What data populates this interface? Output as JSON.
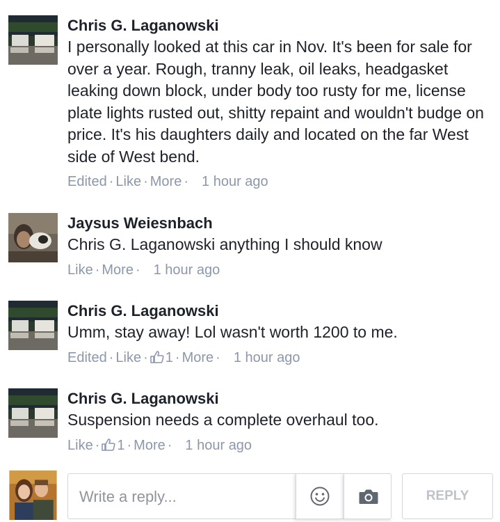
{
  "comments": [
    {
      "author": "Chris G. Laganowski",
      "text": "I personally looked at this car in Nov. It's been for sale for over a year. Rough, tranny leak, oil leaks, headgasket leaking down block, under body too rusty for me, license plate lights rusted out, shitty repaint and wouldn't budge on price. It's his daughters daily and located on the far West side of West bend.",
      "edited": "Edited",
      "like": "Like",
      "more": "More",
      "time": "1 hour ago"
    },
    {
      "author": "Jaysus Weiesnbach",
      "text": "Chris G. Laganowski anything I should know",
      "like": "Like",
      "more": "More",
      "time": "1 hour ago"
    },
    {
      "author": "Chris G. Laganowski",
      "text": "Umm, stay away! Lol wasn't worth 1200 to me.",
      "edited": "Edited",
      "like": "Like",
      "like_count": "1",
      "more": "More",
      "time": "1 hour ago"
    },
    {
      "author": "Chris G. Laganowski",
      "text": "Suspension needs a complete overhaul too.",
      "like": "Like",
      "like_count": "1",
      "more": "More",
      "time": "1 hour ago"
    }
  ],
  "reply_bar": {
    "placeholder": "Write a reply...",
    "reply_label": "REPLY",
    "emoji_icon": "smiley-icon",
    "camera_icon": "camera-icon"
  },
  "colors": {
    "meta": "#8c97ac",
    "text": "#1d2129",
    "border": "#d3d6db"
  }
}
